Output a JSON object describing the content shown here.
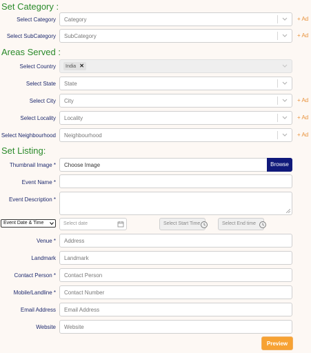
{
  "sections": {
    "category_title": "Set Category :",
    "areas_title": "Areas Served :",
    "listing_title": "Set Listing:"
  },
  "category": {
    "category_label": "Select Category",
    "category_placeholder": "Category",
    "subcategory_label": "Select SubCategory",
    "subcategory_placeholder": "SubCategory",
    "add_text": "+ Ad"
  },
  "areas": {
    "country_label": "Select Country",
    "country_chip": "India",
    "state_label": "Select State",
    "state_placeholder": "State",
    "city_label": "Select City",
    "city_placeholder": "City",
    "locality_label": "Select Locality",
    "locality_placeholder": "Locality",
    "neighbourhood_label": "Select Neighbourhood",
    "neighbourhood_placeholder": "Neighbourhood",
    "add_text": "+ Ad"
  },
  "listing": {
    "thumbnail_label": "Thumbnail Image *",
    "thumbnail_placeholder": "Choose Image",
    "browse_label": "Browse",
    "event_name_label": "Event Name *",
    "event_description_label": "Event Description *",
    "date_type_value": "Event Date & Time",
    "date_placeholder": "Select date",
    "start_time_label": "Select Start Time",
    "end_time_label": "Select End time",
    "venue_label": "Venue *",
    "venue_placeholder": "Address",
    "landmark_label": "Landmark",
    "landmark_placeholder": "Landmark",
    "contact_person_label": "Contact Person *",
    "contact_person_placeholder": "Contact Person",
    "mobile_label": "Mobile/Landline *",
    "mobile_placeholder": "Contact Number",
    "email_label": "Email Address",
    "email_placeholder": "Email Address",
    "website_label": "Website",
    "website_placeholder": "Website",
    "preview_label": "Preview"
  },
  "colors": {
    "section_title": "#2a8a2a",
    "label": "#1e2a6e",
    "add_link": "#e8913a",
    "browse_button": "#10197a",
    "preview_button": "#f7a233",
    "background": "#fdf8f4"
  },
  "icons": [
    "chevron-down-icon",
    "remove-chip-icon",
    "calendar-icon",
    "clock-icon",
    "resize-grip-icon"
  ]
}
